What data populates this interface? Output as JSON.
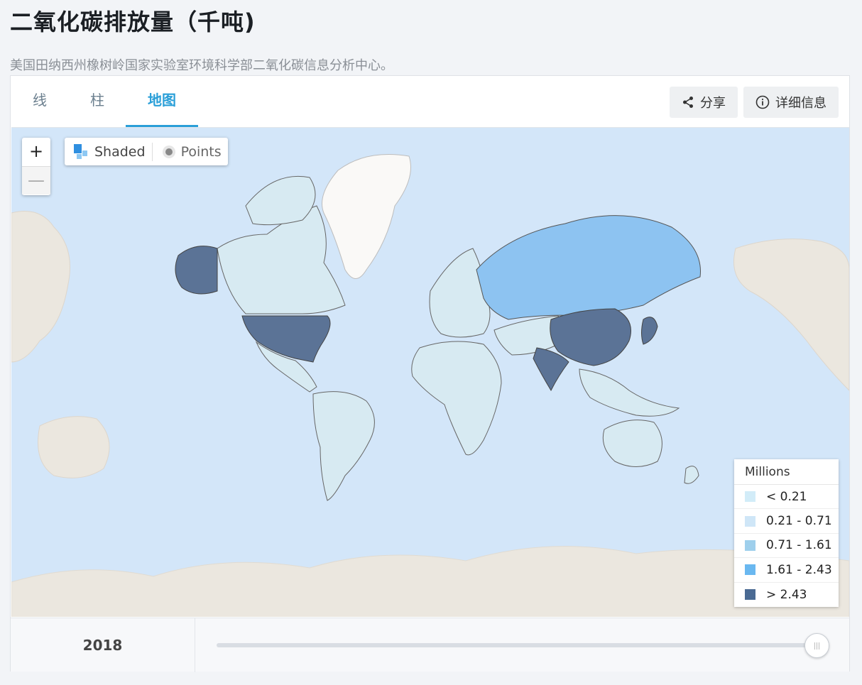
{
  "header": {
    "title": "二氧化碳排放量（千吨)",
    "source": "美国田纳西州橡树岭国家实验室环境科学部二氧化碳信息分析中心。"
  },
  "tabs": [
    {
      "label": "线",
      "active": false
    },
    {
      "label": "柱",
      "active": false
    },
    {
      "label": "地图",
      "active": true
    }
  ],
  "actions": {
    "share_label": "分享",
    "details_label": "详细信息"
  },
  "map": {
    "zoom_in": "+",
    "zoom_out": "—",
    "mode_shaded": "Shaded",
    "mode_points": "Points",
    "active_mode": "Shaded",
    "legend": {
      "title": "Millions",
      "items": [
        {
          "label": "< 0.21",
          "color": "#d2ecf8"
        },
        {
          "label": "0.21 - 0.71",
          "color": "#cfe6f7"
        },
        {
          "label": "0.71 - 1.61",
          "color": "#9ecfec"
        },
        {
          "label": "1.61 - 2.43",
          "color": "#6ab8f0"
        },
        {
          "label": "> 2.43",
          "color": "#4a6a93"
        }
      ]
    },
    "colors": {
      "ocean": "#d3e6f9",
      "land_outside": "#ebe7df",
      "greenland": "#faf9f7"
    }
  },
  "timeline": {
    "year": "2018",
    "position": 1.0
  }
}
